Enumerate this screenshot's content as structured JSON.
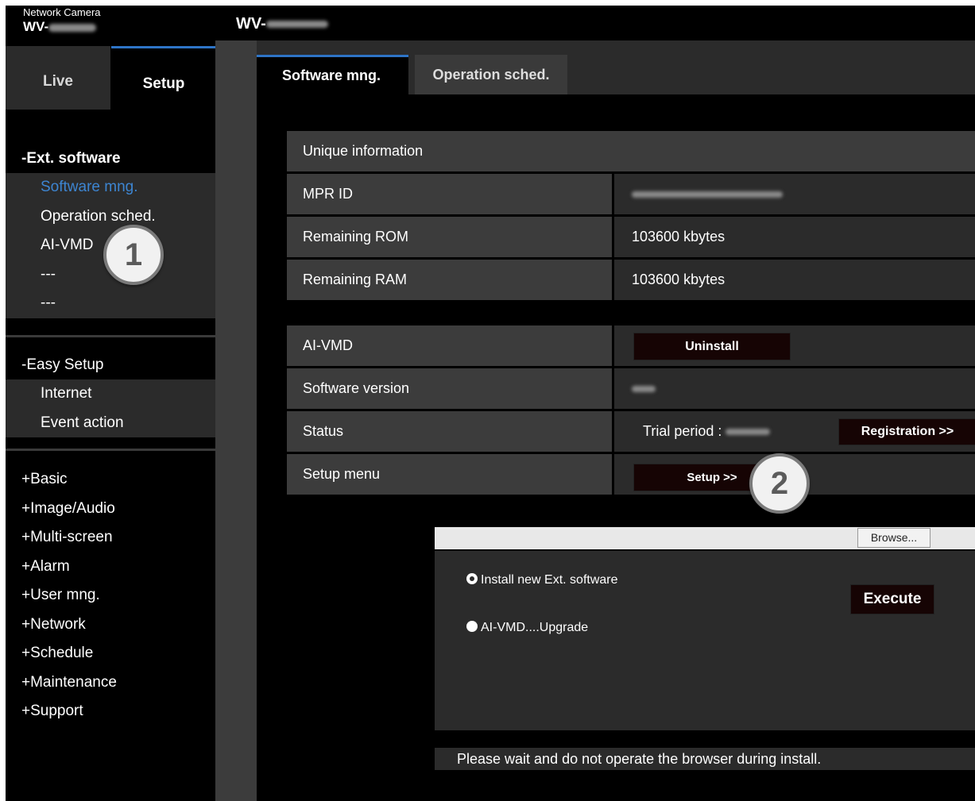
{
  "header": {
    "subtitle": "Network Camera",
    "model_prefix": "WV-",
    "title_prefix": "WV-"
  },
  "nav": {
    "tabs": {
      "live": "Live",
      "setup": "Setup"
    },
    "ext_software": {
      "heading": "-Ext. software",
      "items": [
        "Software mng.",
        "Operation sched.",
        "AI-VMD",
        "---",
        "---"
      ]
    },
    "easy_setup": {
      "heading": "-Easy Setup",
      "items": [
        "Internet",
        "Event action"
      ]
    },
    "groups": [
      "+Basic",
      "+Image/Audio",
      "+Multi-screen",
      "+Alarm",
      "+User mng.",
      "+Network",
      "+Schedule",
      "+Maintenance",
      "+Support"
    ]
  },
  "main": {
    "tabs": {
      "software": "Software mng.",
      "operation": "Operation sched."
    },
    "unique": {
      "heading": "Unique information",
      "mpr_label": "MPR ID",
      "rom_label": "Remaining ROM",
      "rom_value": "103600 kbytes",
      "ram_label": "Remaining RAM",
      "ram_value": "103600 kbytes"
    },
    "app": {
      "name_label": "AI-VMD",
      "uninstall": "Uninstall",
      "version_label": "Software version",
      "status_label": "Status",
      "status_value": "Trial period :",
      "registration": "Registration >>",
      "setup_label": "Setup menu",
      "setup_button": "Setup >>"
    },
    "install": {
      "browse": "Browse...",
      "option_new": "Install new Ext. software",
      "option_upgrade": "AI-VMD....Upgrade",
      "execute": "Execute",
      "note": "Please wait and do not operate the browser during install."
    }
  },
  "callouts": {
    "one": "1",
    "two": "2"
  },
  "colors": {
    "accent": "#2e74c6",
    "active_link": "#3d85d1",
    "panel": "#2b2b2b",
    "label_bg": "#3c3c3c"
  }
}
